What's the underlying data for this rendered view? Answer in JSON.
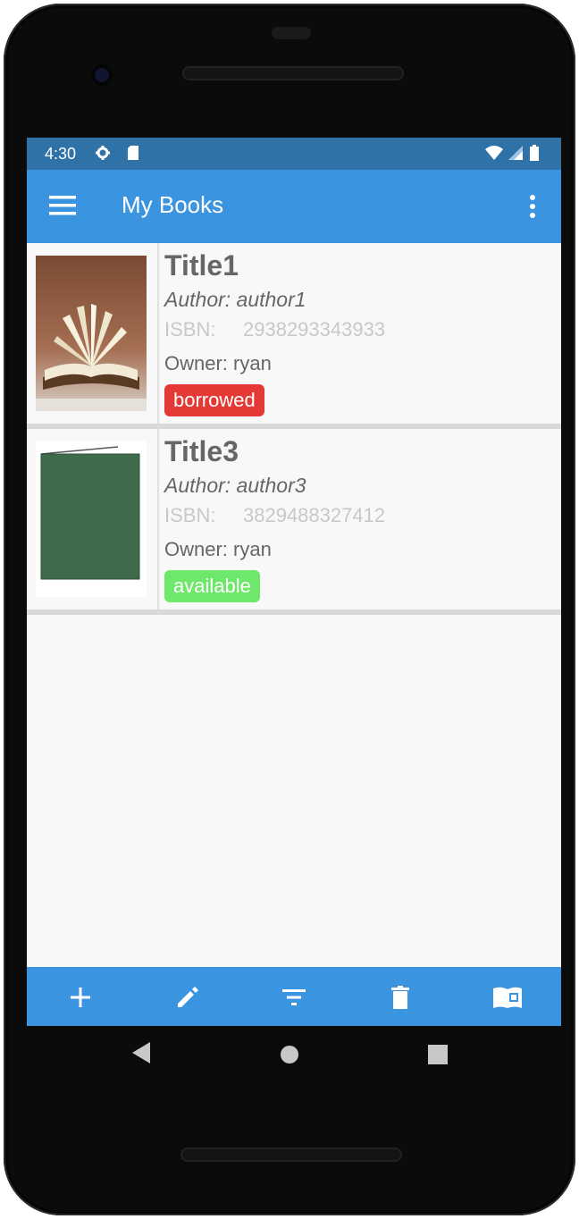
{
  "status_bar": {
    "time": "4:30",
    "icons": [
      "settings-icon",
      "sd-card-icon",
      "wifi-icon",
      "signal-icon",
      "battery-icon"
    ]
  },
  "app_bar": {
    "title": "My Books",
    "menu_icon": "menu-icon",
    "overflow_icon": "more-vert-icon",
    "background": "#3b94e0"
  },
  "books": [
    {
      "title": "Title1",
      "author": "Author: author1",
      "isbn_label": "ISBN:",
      "isbn": "2938293343933",
      "owner": "Owner: ryan",
      "status": "borrowed",
      "status_color": "#e53935",
      "cover": "open-book-photo"
    },
    {
      "title": "Title3",
      "author": "Author: author3",
      "isbn_label": "ISBN:",
      "isbn": "3829488327412",
      "owner": "Owner: ryan",
      "status": "available",
      "status_color": "#6ee86a",
      "cover": "green-book-cover"
    }
  ],
  "bottom_bar": {
    "actions": [
      "add-icon",
      "edit-icon",
      "filter-icon",
      "delete-icon",
      "library-icon"
    ]
  },
  "nav_bar": {
    "buttons": [
      "back-icon",
      "home-icon",
      "recents-icon"
    ]
  }
}
